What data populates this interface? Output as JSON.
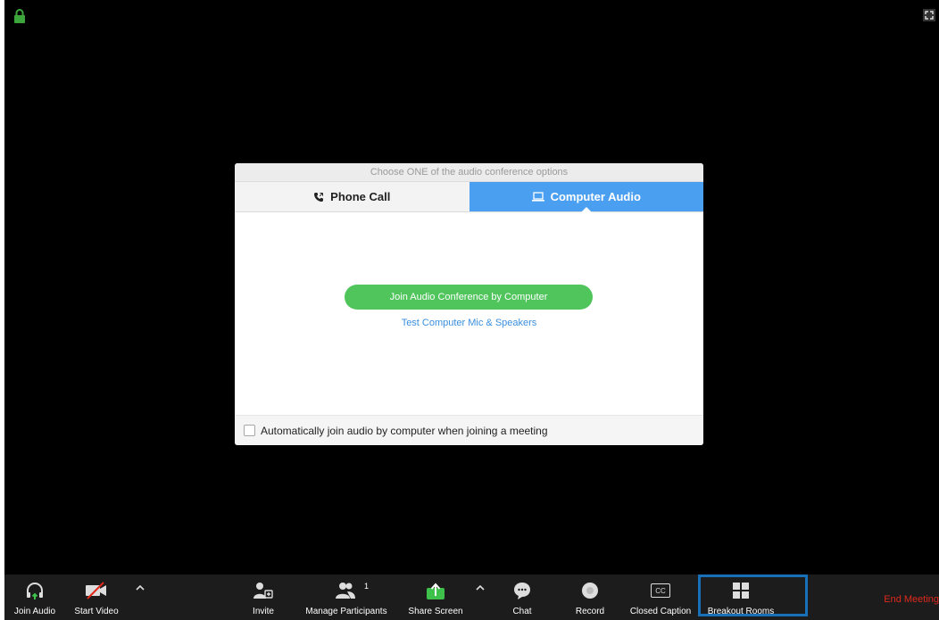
{
  "dialog": {
    "title": "Choose ONE of the audio conference options",
    "tabs": [
      {
        "label": "Phone Call",
        "icon": "phone-icon"
      },
      {
        "label": "Computer Audio",
        "icon": "laptop-icon"
      }
    ],
    "join_button": "Join Audio Conference by Computer",
    "test_link": "Test Computer Mic & Speakers",
    "auto_join_label": "Automatically join audio by computer when joining a meeting"
  },
  "toolbar": {
    "join_audio": "Join Audio",
    "start_video": "Start Video",
    "invite": "Invite",
    "manage_participants": "Manage Participants",
    "participant_count": "1",
    "share_screen": "Share Screen",
    "chat": "Chat",
    "record": "Record",
    "closed_caption": "Closed Caption",
    "cc_icon_text": "CC",
    "breakout_rooms": "Breakout Rooms",
    "end_meeting": "End Meeting"
  },
  "colors": {
    "accent_blue": "#4a9ff1",
    "join_green": "#4fc55c",
    "end_red": "#e0291c",
    "highlight_blue": "#1870b8",
    "lock_green": "#3ca63c"
  }
}
